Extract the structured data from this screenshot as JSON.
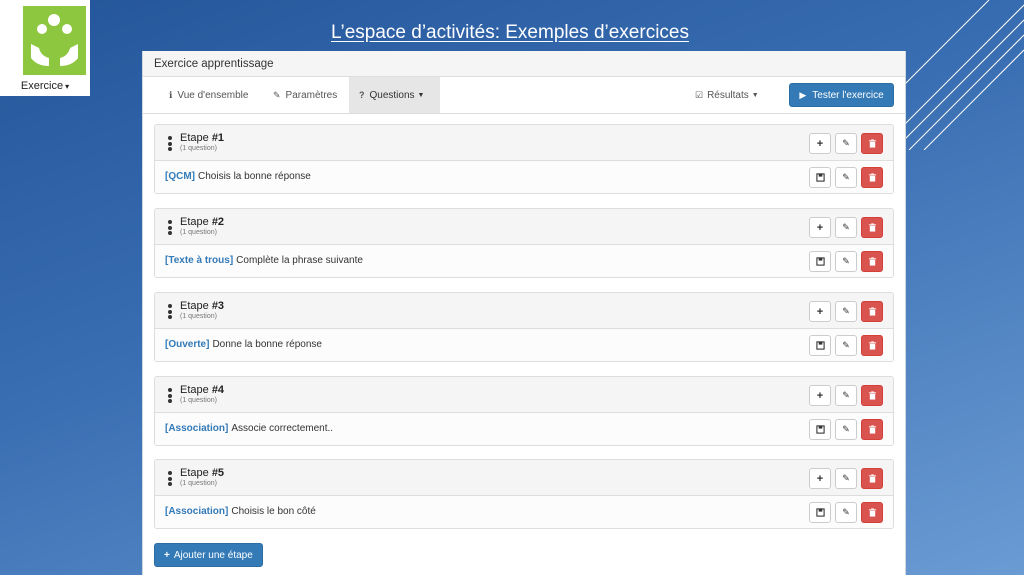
{
  "slide": {
    "title": "L’espace d’activités: Exemples d’exercices"
  },
  "logo": {
    "label": "Exercice",
    "caret": "▾",
    "color": "#8dc63f"
  },
  "panel": {
    "title": "Exercice apprentissage"
  },
  "nav": {
    "overview": "Vue d'ensemble",
    "params": "Paramètres",
    "questions": "Questions",
    "results": "Résultats",
    "test_button": "Tester l'exercice"
  },
  "steps": [
    {
      "label": "Etape",
      "num": "#1",
      "sub": "(1 question)",
      "tag": "[QCM]",
      "question": "Choisis la bonne réponse"
    },
    {
      "label": "Etape",
      "num": "#2",
      "sub": "(1 question)",
      "tag": "[Texte à trous]",
      "question": "Complète la phrase suivante"
    },
    {
      "label": "Etape",
      "num": "#3",
      "sub": "(1 question)",
      "tag": "[Ouverte]",
      "question": "Donne la bonne réponse"
    },
    {
      "label": "Etape",
      "num": "#4",
      "sub": "(1 question)",
      "tag": "[Association]",
      "question": "Associe correctement.."
    },
    {
      "label": "Etape",
      "num": "#5",
      "sub": "(1 question)",
      "tag": "[Association]",
      "question": "Choisis le bon côté"
    }
  ],
  "add_step": "Ajouter une étape",
  "colors": {
    "primary": "#337ab7",
    "danger": "#d9534f",
    "tag": "#337ab7"
  }
}
